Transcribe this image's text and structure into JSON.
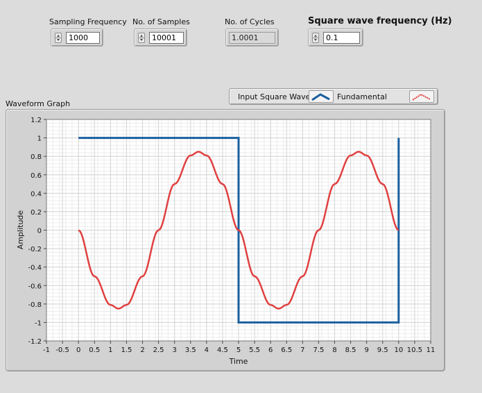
{
  "controls": {
    "sampling_frequency": {
      "label": "Sampling Frequency",
      "value": "1000"
    },
    "num_samples": {
      "label": "No. of Samples",
      "value": "10001"
    },
    "num_cycles": {
      "label": "No. of Cycles",
      "value": "1.0001"
    },
    "square_wave_frequency": {
      "label": "Square wave frequency (Hz)",
      "value": "0.1"
    }
  },
  "graph": {
    "label": "Waveform Graph",
    "legend": [
      {
        "name": "Input Square Wave",
        "color": "#1a5f9e",
        "icon": "square-wave-icon"
      },
      {
        "name": "Fundamental",
        "color": "#e04040",
        "icon": "sine-wave-icon"
      }
    ]
  },
  "chart_data": {
    "type": "line",
    "xlabel": "Time",
    "ylabel": "Amplitude",
    "xlim": [
      -1,
      11
    ],
    "ylim": [
      -1.2,
      1.2
    ],
    "x_ticks": [
      "-1",
      "-0.5",
      "0",
      "0.5",
      "1",
      "1.5",
      "2",
      "2.5",
      "3",
      "3.5",
      "4",
      "4.5",
      "5",
      "5.5",
      "6",
      "6.5",
      "7",
      "7.5",
      "8",
      "8.5",
      "9",
      "9.5",
      "10",
      "10.5",
      "11"
    ],
    "y_ticks": [
      "1.2",
      "1",
      "0.8",
      "0.6",
      "0.4",
      "0.2",
      "0",
      "-0.2",
      "-0.4",
      "-0.6",
      "-0.8",
      "-1",
      "-1.2"
    ],
    "grid": true,
    "series": [
      {
        "name": "Input Square Wave",
        "color": "#1a5f9e",
        "x": [
          0,
          5,
          5,
          10,
          10
        ],
        "y": [
          1,
          1,
          -1,
          -1,
          1
        ]
      },
      {
        "name": "Fundamental",
        "color": "#e04040",
        "x": [
          0,
          0.5,
          1,
          1.25,
          1.5,
          2,
          2.5,
          3,
          3.5,
          3.75,
          4,
          4.5,
          5,
          5.5,
          6,
          6.25,
          6.5,
          7,
          7.5,
          8,
          8.5,
          8.75,
          9,
          9.5,
          10
        ],
        "y": [
          0,
          -0.5,
          -0.81,
          -0.85,
          -0.81,
          -0.5,
          0,
          0.5,
          0.81,
          0.85,
          0.81,
          0.5,
          0,
          -0.5,
          -0.81,
          -0.85,
          -0.81,
          -0.5,
          0,
          0.5,
          0.81,
          0.85,
          0.81,
          0.5,
          0
        ]
      }
    ]
  }
}
